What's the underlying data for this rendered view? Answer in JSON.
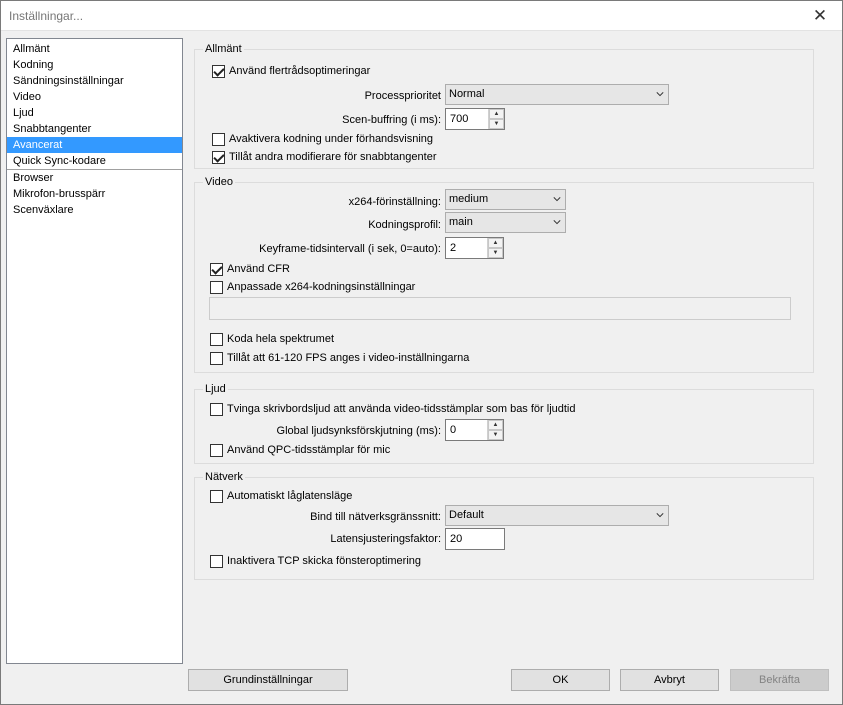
{
  "window": {
    "title": "Inställningar...",
    "close_icon": "close-icon"
  },
  "sidebar": {
    "items": [
      {
        "label": "Allmänt"
      },
      {
        "label": "Kodning"
      },
      {
        "label": "Sändningsinställningar"
      },
      {
        "label": "Video"
      },
      {
        "label": "Ljud"
      },
      {
        "label": "Snabbtangenter"
      },
      {
        "label": "Avancerat",
        "selected": true
      },
      {
        "label": "Quick Sync-kodare"
      },
      {
        "label": "Browser"
      },
      {
        "label": "Mikrofon-brusspärr"
      },
      {
        "label": "Scenväxlare"
      }
    ]
  },
  "general": {
    "title": "Allmänt",
    "multithread": {
      "label": "Använd flertrådsoptimeringar",
      "checked": true
    },
    "priority": {
      "label": "Processprioritet",
      "value": "Normal"
    },
    "scene_buffer": {
      "label": "Scen-buffring (i ms):",
      "value": "700"
    },
    "disable_preview_encoding": {
      "label": "Avaktivera kodning under förhandsvisning",
      "checked": false
    },
    "allow_modifiers": {
      "label": "Tillåt andra modifierare för snabbtangenter",
      "checked": true
    }
  },
  "video": {
    "title": "Video",
    "preset": {
      "label": "x264-förinställning:",
      "value": "medium"
    },
    "profile": {
      "label": "Kodningsprofil:",
      "value": "main"
    },
    "keyframe": {
      "label": "Keyframe-tidsintervall (i sek, 0=auto):",
      "value": "2"
    },
    "cfr": {
      "label": "Använd CFR",
      "checked": true
    },
    "custom_x264": {
      "label": "Anpassade x264-kodningsinställningar",
      "checked": false,
      "value": ""
    },
    "full_range": {
      "label": "Koda hela spektrumet",
      "checked": false
    },
    "high_fps": {
      "label": "Tillåt att 61-120 FPS anges i video-inställningarna",
      "checked": false
    }
  },
  "audio": {
    "title": "Ljud",
    "force_desktop": {
      "label": "Tvinga skrivbordsljud att använda video-tidsstämplar som bas för ljudtid",
      "checked": false
    },
    "sync_offset": {
      "label": "Global ljudsynksförskjutning (ms):",
      "value": "0"
    },
    "qpc": {
      "label": "Använd QPC-tidsstämplar för mic",
      "checked": false
    }
  },
  "network": {
    "title": "Nätverk",
    "low_latency": {
      "label": "Automatiskt låglatensläge",
      "checked": false
    },
    "bind": {
      "label": "Bind till nätverksgränssnitt:",
      "value": "Default"
    },
    "latency_factor": {
      "label": "Latensjusteringsfaktor:",
      "value": "20"
    },
    "tcp_window": {
      "label": "Inaktivera TCP skicka fönsteroptimering",
      "checked": false
    }
  },
  "buttons": {
    "defaults": "Grundinställningar",
    "ok": "OK",
    "cancel": "Avbryt",
    "apply": "Bekräfta"
  },
  "colors": {
    "selection": "#3399ff",
    "background": "#f0f0f0"
  }
}
